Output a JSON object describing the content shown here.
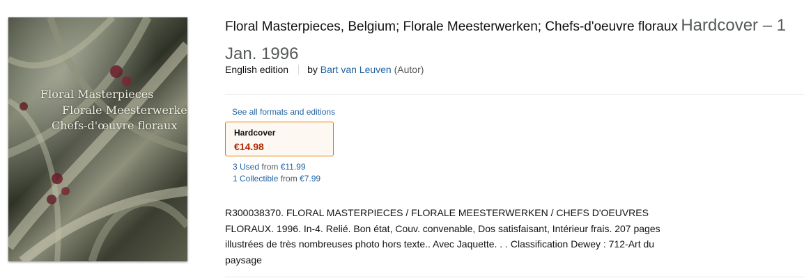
{
  "cover": {
    "title_lines": [
      "Floral Masterpieces",
      "Florale Meesterwerken",
      "Chefs-d'œuvre floraux"
    ]
  },
  "product": {
    "title": "Floral Masterpieces, Belgium; Florale Meesterwerken; Chefs-d'oeuvre floraux",
    "format_date": "Hardcover – 1 Jan. 1996",
    "edition": "English edition",
    "by_label": "by",
    "author": "Bart van Leuven",
    "author_role": "(Autor)"
  },
  "formats": {
    "see_all_label": "See all formats and editions",
    "selected": {
      "format": "Hardcover",
      "price": "€14.98"
    },
    "offers": [
      {
        "count_label": "3 Used",
        "from_label": "from",
        "price": "€11.99"
      },
      {
        "count_label": "1 Collectible",
        "from_label": "from",
        "price": "€7.99"
      }
    ]
  },
  "description": "R300038370. FLORAL MASTERPIECES / FLORALE MEESTERWERKEN / CHEFS D'OEUVRES FLORAUX. 1996. In-4. Relié. Bon état, Couv. convenable, Dos satisfaisant, Intérieur frais. 207 pages illustrées de très nombreuses photo hors texte.. Avec Jaquette. . . Classification Dewey : 712-Art du paysage",
  "colors": {
    "link": "#2162a1",
    "price": "#b12704",
    "selected_border": "#e77600",
    "selected_bg": "#fef8f2"
  }
}
